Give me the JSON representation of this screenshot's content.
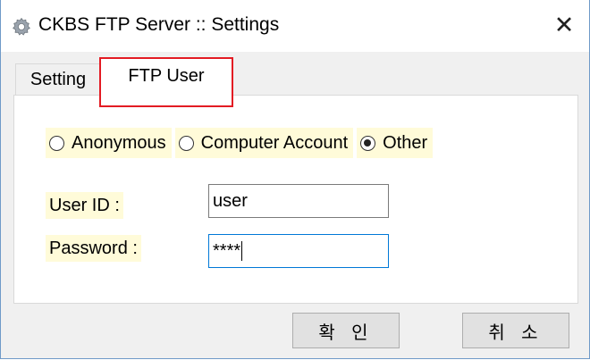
{
  "window": {
    "title": "CKBS FTP Server :: Settings",
    "close_glyph": "✕"
  },
  "tabs": [
    {
      "label": "Setting",
      "selected": false
    },
    {
      "label": "FTP User",
      "selected": true
    }
  ],
  "auth_mode": {
    "options": [
      {
        "label": "Anonymous",
        "checked": false
      },
      {
        "label": "Computer Account",
        "checked": false
      },
      {
        "label": "Other",
        "checked": true
      }
    ]
  },
  "form": {
    "user_id_label": "User ID :",
    "user_id_value": "user",
    "password_label": "Password :",
    "password_value": "****"
  },
  "buttons": {
    "ok_label": "확 인",
    "cancel_label": "취 소"
  },
  "colors": {
    "highlight": "#e31b23",
    "label_bg": "#fffbd9",
    "focus_border": "#0078d7"
  },
  "icons": {
    "app": "gear-icon",
    "close": "close-icon"
  }
}
